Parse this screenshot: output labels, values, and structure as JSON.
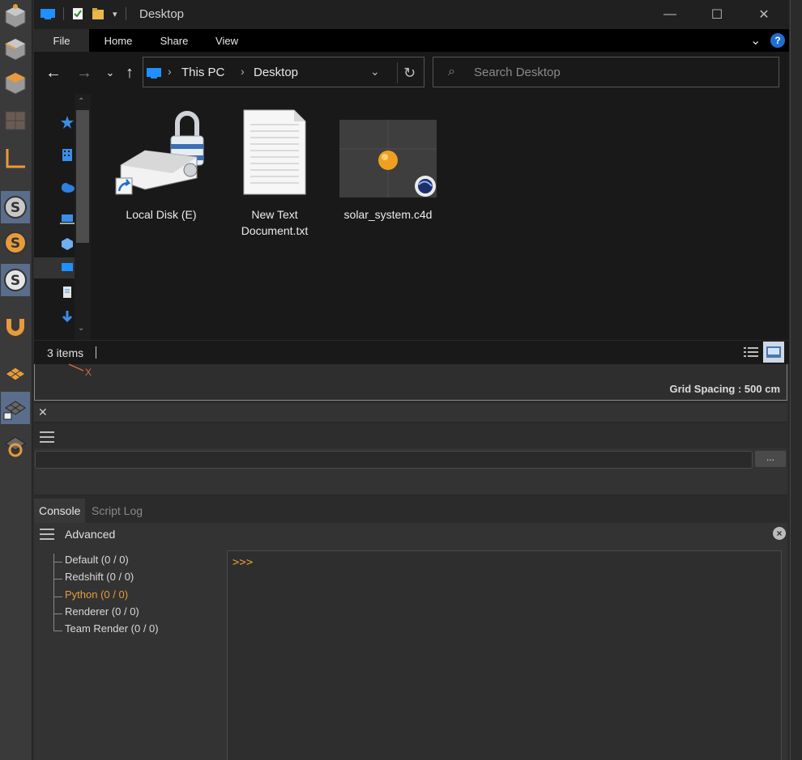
{
  "explorer": {
    "window_title": "Desktop",
    "ribbon_tabs": [
      "File",
      "Home",
      "Share",
      "View"
    ],
    "help_label": "?",
    "breadcrumb": [
      "This PC",
      "Desktop"
    ],
    "search_placeholder": "Search Desktop",
    "items": [
      {
        "label": "Local Disk (E)"
      },
      {
        "label": "New Text Document.txt"
      },
      {
        "label": "solar_system.c4d"
      }
    ],
    "status_count": "3 items"
  },
  "viewport": {
    "grid_spacing": "Grid Spacing : 500 cm",
    "axis_label": "X"
  },
  "commandline": {
    "browse_label": "..."
  },
  "console": {
    "tabs": [
      "Console",
      "Script Log"
    ],
    "header_title": "Advanced",
    "tree": [
      {
        "label": "Default (0 / 0)",
        "active": false
      },
      {
        "label": "Redshift (0 / 0)",
        "active": false
      },
      {
        "label": "Python (0 / 0)",
        "active": true
      },
      {
        "label": "Renderer (0 / 0)",
        "active": false
      },
      {
        "label": "Team Render  (0 / 0)",
        "active": false
      }
    ],
    "prompt": ">>>"
  },
  "colors": {
    "accent_orange": "#e89b3a",
    "toolbar_selected": "#5a6d8a",
    "folder_blue": "#1e90ff"
  }
}
